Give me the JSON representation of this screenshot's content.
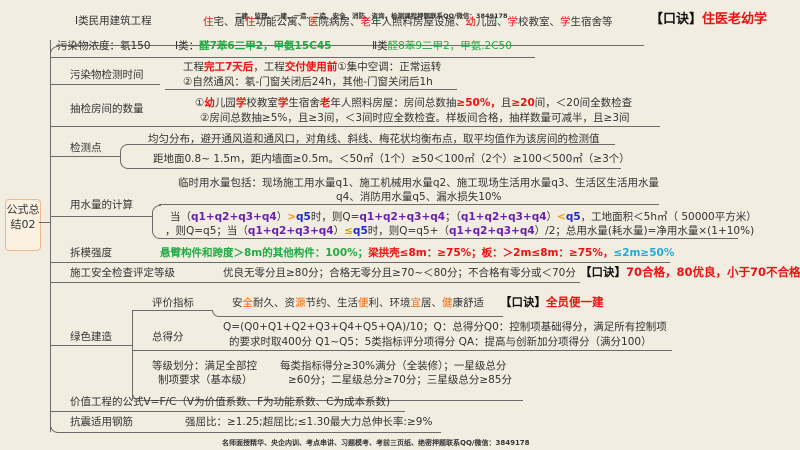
{
  "root": {
    "label": "公式总结02"
  },
  "watermark_top": "二建、监理、一建、一造、二造、安全、消防、咨询、检测课程押题联系QQ/微信：3849178",
  "footer": "名师面授精华、央企内训、考点串讲、习题模考、考前三页纸、绝密押题联系QQ/微信：3849178",
  "colors": {
    "red": "#ee1111",
    "green": "#22aa44",
    "purple": "#6a1fb0",
    "blue": "#1e2ad8",
    "orange": "#ff6600",
    "cyan": "#22aadd",
    "yellow": "#ccaa00"
  },
  "branches": {
    "b1": {
      "label": "Ⅰ类民用建筑工程",
      "content": [
        {
          "t": "住",
          "c": "#ee1111"
        },
        {
          "t": "宅、居"
        },
        {
          "t": "住",
          "c": "#ee1111"
        },
        {
          "t": "功能公寓、"
        },
        {
          "t": "医",
          "c": "#ee1111"
        },
        {
          "t": "院病房、"
        },
        {
          "t": "老",
          "c": "#ee1111"
        },
        {
          "t": "年人照料房屋设施、"
        },
        {
          "t": "幼",
          "c": "#ee1111"
        },
        {
          "t": "儿园、"
        },
        {
          "t": "学",
          "c": "#ee1111"
        },
        {
          "t": "校教室、"
        },
        {
          "t": "学",
          "c": "#ee1111"
        },
        {
          "t": "生宿舍等"
        }
      ],
      "mnemonic": [
        {
          "t": "【口诀】",
          "c": "#111",
          "b": 1
        },
        {
          "t": "住医老幼学",
          "c": "#ee1111",
          "b": 1
        }
      ]
    },
    "b2": {
      "label": "污染物浓度：氡150",
      "content": [
        {
          "t": "Ⅰ类："
        },
        {
          "t": "醛7苯6二甲2，甲氨15C45",
          "c": "#22aa44",
          "b": 1
        }
      ],
      "content2": [
        {
          "t": "Ⅱ类"
        },
        {
          "t": "醛8苯9二甲2，甲氨.2C50",
          "c": "#22aa44"
        }
      ]
    },
    "b3": {
      "label": "污染物检测时间",
      "line1": [
        {
          "t": "工程"
        },
        {
          "t": "完工7天后",
          "c": "#ee1111",
          "b": 1
        },
        {
          "t": "，工程"
        },
        {
          "t": "交付使用前",
          "c": "#ee1111",
          "b": 1
        },
        {
          "t": "①集中空调：正常运转"
        }
      ],
      "line2": [
        {
          "t": "②自然通风：氡-门窗关闭后24h，其他-门窗关闭后1h"
        }
      ]
    },
    "b4": {
      "label": "抽检房间的数量",
      "line1": [
        {
          "t": "①"
        },
        {
          "t": "幼",
          "c": "#ee1111",
          "b": 1
        },
        {
          "t": "儿园"
        },
        {
          "t": "学",
          "c": "#ee1111",
          "b": 1
        },
        {
          "t": "校教室"
        },
        {
          "t": "学",
          "c": "#ee1111",
          "b": 1
        },
        {
          "t": "生宿舍"
        },
        {
          "t": "老",
          "c": "#ee1111",
          "b": 1
        },
        {
          "t": "年人照料房屋：房间总数抽"
        },
        {
          "t": "≥50%，",
          "c": "#ee1111",
          "b": 1
        },
        {
          "t": "且"
        },
        {
          "t": "≥20",
          "c": "#ee1111",
          "b": 1
        },
        {
          "t": "间，＜20间全数检查"
        }
      ],
      "line2": [
        {
          "t": "②房间总数抽≥5%，且≥3间，＜3间时应全数检查。样板间合格，抽样数量可减半，且≥3间"
        }
      ]
    },
    "b5": {
      "label": "检测点",
      "line1": [
        {
          "t": "均匀分布，避开通风道和通风口，对角线、斜线、梅花状均衡布点，取平均值作为该房间的检测值"
        }
      ],
      "line2": [
        {
          "t": "距地面0.8~ 1.5m，距内墙面≥0.5m。＜50㎡（1个）≥50＜100㎡（2个）≥100＜500㎡（≥3个）"
        }
      ]
    },
    "b6": {
      "label": "用水量的计算",
      "line1": [
        {
          "t": "临时用水量包括：现场施工用水量q1、施工机械用水量q2、施工现场生活用水量q3、生活区生活用水量"
        }
      ],
      "line2": [
        {
          "t": "q4、消防用水量q5、漏水损失10%"
        }
      ],
      "line3": [
        {
          "t": "当（"
        },
        {
          "t": "q1+q2+q3+q4",
          "c": "#6a1fb0",
          "b": 1
        },
        {
          "t": "）"
        },
        {
          "t": ">",
          "c": "#ff9900",
          "b": 1
        },
        {
          "t": "q5",
          "c": "#1e2ad8",
          "b": 1
        },
        {
          "t": "时，则Q="
        },
        {
          "t": "q1+q2+q3+q4",
          "c": "#6a1fb0",
          "b": 1
        },
        {
          "t": "；（"
        },
        {
          "t": "q1+q2+q3+q4",
          "c": "#6a1fb0",
          "b": 1
        },
        {
          "t": "）"
        },
        {
          "t": "<",
          "c": "#ff9900",
          "b": 1
        },
        {
          "t": "q5",
          "c": "#1e2ad8",
          "b": 1
        },
        {
          "t": "，工地面积＜5h㎡（ 50000平方米）"
        }
      ],
      "line4": [
        {
          "t": "，则Q=q5；当（"
        },
        {
          "t": "q1+q2+q3+q4",
          "c": "#6a1fb0",
          "b": 1
        },
        {
          "t": "）"
        },
        {
          "t": "≤",
          "c": "#ccaa00",
          "b": 1
        },
        {
          "t": "q5",
          "c": "#1e2ad8",
          "b": 1
        },
        {
          "t": "时，则Q=q5+（"
        },
        {
          "t": "q1+q2+q3+q4",
          "c": "#6a1fb0",
          "b": 1
        },
        {
          "t": "）/2；总用水量(耗水量)=净用水量×(1+10%)"
        }
      ]
    },
    "b7": {
      "label": "拆模强度",
      "content": [
        {
          "t": "悬臂构件和跨度＞8m的其他构件：100%；",
          "c": "#22aa44",
          "b": 1
        },
        {
          "t": "梁拱壳≤8m：≥75%；板：＞2m≤8m：≥75%，",
          "c": "#ee1111",
          "b": 1
        },
        {
          "t": "≤2m≥50%",
          "c": "#22aadd",
          "b": 1
        }
      ]
    },
    "b8": {
      "label": "施工安全检查评定等级",
      "content": [
        {
          "t": "优良无零分且≥80分；合格无零分且≥70~＜80分；不合格有零分或＜70分"
        }
      ],
      "mnemonic": [
        {
          "t": "【口诀】",
          "c": "#111",
          "b": 1
        },
        {
          "t": "70合格，80优良，小于70不合格",
          "c": "#ee1111",
          "b": 1
        }
      ]
    },
    "b9": {
      "label": "绿色建造",
      "sub1": {
        "label": "评价指标",
        "content": [
          {
            "t": "安"
          },
          {
            "t": "全",
            "c": "#ff6600"
          },
          {
            "t": "耐久、资"
          },
          {
            "t": "源",
            "c": "#ff6600"
          },
          {
            "t": "节约、生活"
          },
          {
            "t": "便",
            "c": "#ff6600"
          },
          {
            "t": "利、环境"
          },
          {
            "t": "宜",
            "c": "#ff6600"
          },
          {
            "t": "居、"
          },
          {
            "t": "健",
            "c": "#ff6600"
          },
          {
            "t": "康舒适"
          }
        ],
        "mnemonic": [
          {
            "t": "【口诀】",
            "c": "#111",
            "b": 1
          },
          {
            "t": "全员便一建",
            "c": "#ee1111",
            "b": 1
          }
        ]
      },
      "sub2": {
        "label": "总得分",
        "line1": [
          {
            "t": "Q=(Q0+Q1+Q2+Q3+Q4+Q5+QA)/10；Q：总得分Q0：控制项基础得分，满足所有控制项"
          }
        ],
        "line2": [
          {
            "t": "的要求时取400分  Q1~Q5：5类指标评分项得分  QA：提高与创新加分项得分（满分100）"
          }
        ]
      },
      "sub3": {
        "label1": "等级划分：满足全部控",
        "label2": "制项要求（基本级）",
        "line1": [
          {
            "t": "每类指标得分≥30%满分（全装修）；一星级总分"
          }
        ],
        "line2": [
          {
            "t": "≥60分；二星级总分≥70分；三星级总分≥85分"
          }
        ]
      }
    },
    "b10": {
      "label": "价值工程的公式V=F/C（V为价值系数、F为功能系数、C为成本系数)"
    },
    "b11": {
      "label": "抗震适用钢筋",
      "content": [
        {
          "t": "强屈比：≥1.25;超屈比;≤1.30最大力总伸长率:≥9%"
        }
      ]
    }
  }
}
